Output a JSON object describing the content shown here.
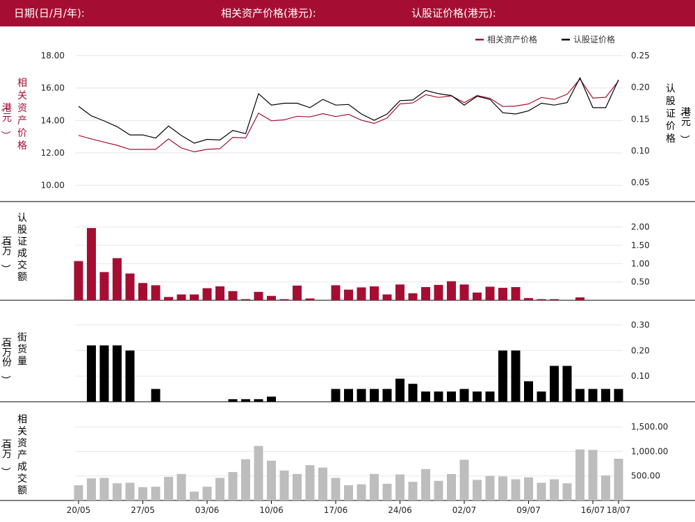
{
  "header": {
    "date_label": "日期(日/月/年):",
    "asset_price_label": "相关资产价格(港元):",
    "warrant_price_label": "认股证价格(港元):"
  },
  "colors": {
    "header_bg": "#a50e32",
    "asset": "#a50e32",
    "warrant": "#000000",
    "outstanding": "#000000",
    "asset_turnover": "#bdbdbd",
    "grid": "#e6e6e6"
  },
  "chart_data": [
    {
      "type": "line",
      "name": "price",
      "legend": [
        "相关资产价格",
        "认股证价格"
      ],
      "ylabel_left": "相关资产价格（港元）",
      "ylabel_right": "认股证价格（港元）",
      "ylim_left": [
        9,
        18
      ],
      "yticks_left": [
        "18.00",
        "16.00",
        "14.00",
        "12.00",
        "10.00"
      ],
      "ylim_right": [
        0.02,
        0.25
      ],
      "yticks_right": [
        "0.25",
        "0.20",
        "0.15",
        "0.10",
        "0.05"
      ],
      "series": [
        {
          "name": "相关资产价格",
          "axis": "left",
          "values": [
            13.08,
            12.86,
            12.66,
            12.47,
            12.22,
            12.22,
            12.22,
            12.86,
            12.3,
            12.07,
            12.22,
            12.26,
            12.96,
            12.92,
            14.45,
            13.98,
            14.04,
            14.26,
            14.22,
            14.42,
            14.24,
            14.38,
            14.02,
            13.82,
            14.15,
            15.02,
            15.08,
            15.59,
            15.42,
            15.52,
            15.1,
            15.54,
            15.37,
            14.86,
            14.89,
            15.02,
            15.42,
            15.3,
            15.62,
            16.55,
            15.38,
            15.43,
            16.44
          ]
        },
        {
          "name": "认股证价格",
          "axis": "right",
          "values": [
            0.17,
            0.155,
            0.147,
            0.138,
            0.125,
            0.125,
            0.12,
            0.139,
            0.124,
            0.112,
            0.118,
            0.117,
            0.132,
            0.127,
            0.19,
            0.172,
            0.175,
            0.175,
            0.168,
            0.181,
            0.172,
            0.173,
            0.158,
            0.148,
            0.158,
            0.179,
            0.18,
            0.195,
            0.19,
            0.187,
            0.172,
            0.186,
            0.181,
            0.16,
            0.158,
            0.163,
            0.175,
            0.172,
            0.176,
            0.215,
            0.168,
            0.168,
            0.212
          ]
        }
      ]
    },
    {
      "type": "bar",
      "name": "warrant_turnover",
      "ylabel": "认股证成交额（百万）",
      "ylim": [
        0,
        2.2
      ],
      "yticks": [
        "2.00",
        "1.50",
        "1.00",
        "0.50"
      ],
      "values": [
        1.07,
        1.97,
        0.77,
        1.15,
        0.73,
        0.47,
        0.41,
        0.09,
        0.16,
        0.16,
        0.33,
        0.38,
        0.25,
        0.03,
        0.23,
        0.12,
        0.03,
        0.4,
        0.05,
        0,
        0.41,
        0.29,
        0.35,
        0.38,
        0.16,
        0.43,
        0.19,
        0.36,
        0.42,
        0.52,
        0.43,
        0.21,
        0.37,
        0.34,
        0.36,
        0.06,
        0.03,
        0.03,
        0,
        0.08,
        0,
        0,
        0
      ]
    },
    {
      "type": "bar",
      "name": "outstanding",
      "ylabel": "街货量（百万份）",
      "ylim": [
        0,
        0.32
      ],
      "yticks": [
        "0.30",
        "0.20",
        "0.10"
      ],
      "values": [
        0,
        0.22,
        0.22,
        0.22,
        0.2,
        0,
        0.05,
        0,
        0,
        0,
        0,
        0,
        0.01,
        0.01,
        0.01,
        0.02,
        0,
        0,
        0,
        0,
        0.05,
        0.05,
        0.05,
        0.05,
        0.05,
        0.09,
        0.07,
        0.04,
        0.04,
        0.04,
        0.05,
        0.04,
        0.04,
        0.2,
        0.2,
        0.08,
        0.04,
        0.14,
        0.14,
        0.05,
        0.05,
        0.05,
        0.05
      ]
    },
    {
      "type": "bar",
      "name": "asset_turnover",
      "ylabel": "相关资产成交额（百万）",
      "ylim": [
        0,
        1700
      ],
      "yticks": [
        "1,500.00",
        "1,000.00",
        "500.00"
      ],
      "values": [
        310,
        450,
        460,
        350,
        360,
        270,
        280,
        480,
        540,
        180,
        280,
        460,
        580,
        840,
        1110,
        810,
        610,
        540,
        720,
        670,
        460,
        310,
        330,
        540,
        340,
        530,
        380,
        640,
        400,
        540,
        830,
        420,
        500,
        490,
        430,
        470,
        360,
        430,
        350,
        1040,
        1030,
        510,
        850
      ]
    }
  ],
  "x_ticks": [
    {
      "index": 0,
      "label": "20/05"
    },
    {
      "index": 5,
      "label": "27/05"
    },
    {
      "index": 10,
      "label": "03/06"
    },
    {
      "index": 15,
      "label": "10/06"
    },
    {
      "index": 20,
      "label": "17/06"
    },
    {
      "index": 25,
      "label": "24/06"
    },
    {
      "index": 30,
      "label": "02/07"
    },
    {
      "index": 35,
      "label": "09/07"
    },
    {
      "index": 40,
      "label": "16/07"
    },
    {
      "index": 42,
      "label": "18/07"
    }
  ]
}
